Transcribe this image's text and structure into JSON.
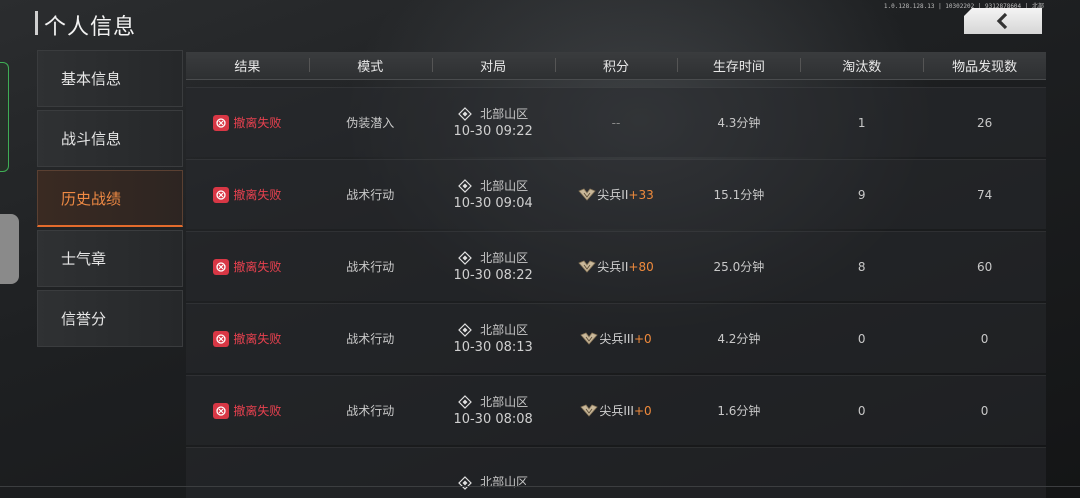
{
  "header": {
    "title": "个人信息",
    "version": "1.0.128.128.13 | 10302202 | 9312878604 | 北部",
    "back_icon": "chevron-left-icon"
  },
  "sidebar": {
    "items": [
      {
        "label": "基本信息",
        "active": false
      },
      {
        "label": "战斗信息",
        "active": false
      },
      {
        "label": "历史战绩",
        "active": true
      },
      {
        "label": "士气章",
        "active": false
      },
      {
        "label": "信誉分",
        "active": false
      }
    ]
  },
  "colors": {
    "accent": "#e36b2c",
    "fail": "#d83745",
    "delta": "#ef8a3c"
  },
  "table": {
    "headers": [
      "结果",
      "模式",
      "对局",
      "积分",
      "生存时间",
      "淘汰数",
      "物品发现数"
    ],
    "rows": [
      {
        "result": "撤离失败",
        "mode": "伪装潜入",
        "map": "北部山区",
        "time": "10-30 09:22",
        "rank": "",
        "delta": "",
        "score_text": "--",
        "survival": "4.3分钟",
        "kills": "1",
        "items": "26"
      },
      {
        "result": "撤离失败",
        "mode": "战术行动",
        "map": "北部山区",
        "time": "10-30 09:04",
        "rank": "尖兵II",
        "delta": "+33",
        "score_text": "",
        "survival": "15.1分钟",
        "kills": "9",
        "items": "74"
      },
      {
        "result": "撤离失败",
        "mode": "战术行动",
        "map": "北部山区",
        "time": "10-30 08:22",
        "rank": "尖兵II",
        "delta": "+80",
        "score_text": "",
        "survival": "25.0分钟",
        "kills": "8",
        "items": "60"
      },
      {
        "result": "撤离失败",
        "mode": "战术行动",
        "map": "北部山区",
        "time": "10-30 08:13",
        "rank": "尖兵III",
        "delta": "+0",
        "score_text": "",
        "survival": "4.2分钟",
        "kills": "0",
        "items": "0"
      },
      {
        "result": "撤离失败",
        "mode": "战术行动",
        "map": "北部山区",
        "time": "10-30 08:08",
        "rank": "尖兵III",
        "delta": "+0",
        "score_text": "",
        "survival": "1.6分钟",
        "kills": "0",
        "items": "0"
      },
      {
        "result": "",
        "mode": "",
        "map": "北部山区",
        "time": "",
        "rank": "",
        "delta": "",
        "score_text": "",
        "survival": "",
        "kills": "",
        "items": ""
      }
    ]
  }
}
